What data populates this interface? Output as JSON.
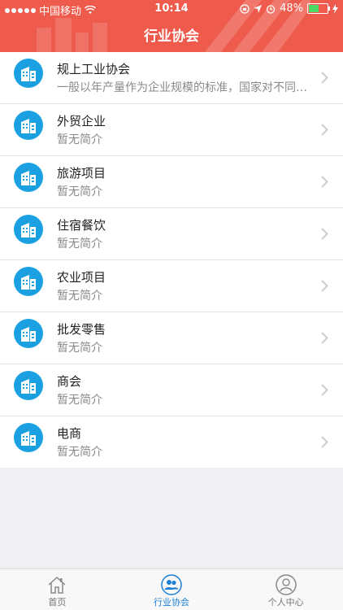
{
  "status": {
    "carrier": "中国移动",
    "time": "10:14",
    "battery": "48%",
    "battery_level": 0.48
  },
  "header": {
    "title": "行业协会"
  },
  "items": [
    {
      "name": "规上工业协会",
      "desc": "一般以年产量作为企业规模的标准，国家对不同行业的企业都制定了..."
    },
    {
      "name": "外贸企业",
      "desc": "暂无简介"
    },
    {
      "name": "旅游项目",
      "desc": "暂无简介"
    },
    {
      "name": "住宿餐饮",
      "desc": "暂无简介"
    },
    {
      "name": "农业项目",
      "desc": "暂无简介"
    },
    {
      "name": "批发零售",
      "desc": "暂无简介"
    },
    {
      "name": "商会",
      "desc": "暂无简介"
    },
    {
      "name": "电商",
      "desc": "暂无简介"
    }
  ],
  "tabs": [
    {
      "label": "首页",
      "icon": "home-icon",
      "active": false
    },
    {
      "label": "行业协会",
      "icon": "users-icon",
      "active": true
    },
    {
      "label": "个人中心",
      "icon": "user-icon",
      "active": false
    }
  ],
  "colors": {
    "header": "#ee5a4b",
    "accent": "#1ba1e2",
    "active_tab": "#1e7fd6"
  }
}
